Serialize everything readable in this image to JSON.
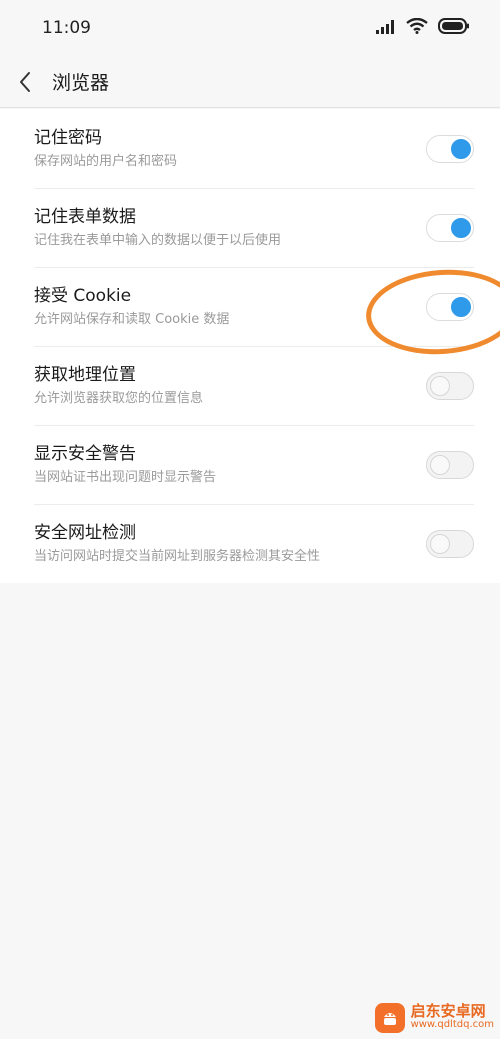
{
  "status_bar": {
    "time": "11:09",
    "icons": [
      "signal-icon",
      "wifi-icon",
      "battery-icon"
    ]
  },
  "header": {
    "title": "浏览器",
    "back_icon": "chevron-left-icon"
  },
  "settings": [
    {
      "title": "记住密码",
      "subtitle": "保存网站的用户名和密码",
      "enabled": true
    },
    {
      "title": "记住表单数据",
      "subtitle": "记住我在表单中输入的数据以便于以后使用",
      "enabled": true
    },
    {
      "title": "接受 Cookie",
      "subtitle": "允许网站保存和读取 Cookie 数据",
      "enabled": true
    },
    {
      "title": "获取地理位置",
      "subtitle": "允许浏览器获取您的位置信息",
      "enabled": false
    },
    {
      "title": "显示安全警告",
      "subtitle": "当网站证书出现问题时显示警告",
      "enabled": false
    },
    {
      "title": "安全网址检测",
      "subtitle": "当访问网站时提交当前网址到服务器检测其安全性",
      "enabled": false
    }
  ],
  "colors": {
    "toggle_on": "#2f9ae9",
    "annotation": "#f08a2f",
    "background": "#f7f7f7"
  },
  "watermark": {
    "name": "启东安卓网",
    "url": "www.qdltdq.com"
  }
}
